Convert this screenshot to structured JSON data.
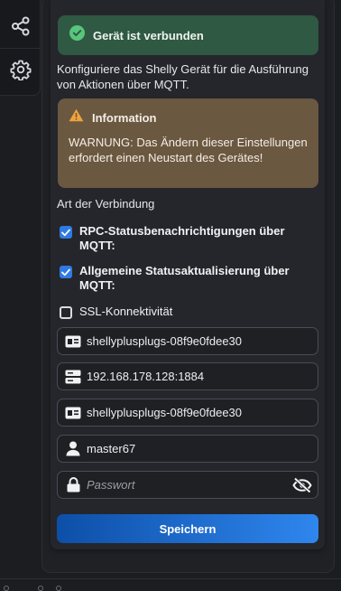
{
  "rail": {
    "icons": [
      "share-icon",
      "gear-icon"
    ]
  },
  "status": {
    "message": "Gerät ist verbunden",
    "color": "#2f5942"
  },
  "description": "Konfiguriere das Shelly Gerät für die Ausführung von Aktionen über MQTT.",
  "info": {
    "title": "Information",
    "body": "WARNUNG: Das Ändern dieser Einstellungen erfordert einen Neustart des Gerätes!",
    "color": "#6b5840"
  },
  "connection": {
    "label": "Art der Verbindung",
    "options": [
      {
        "label": "RPC-Statusbenachrichtigungen über MQTT:",
        "checked": true
      },
      {
        "label": "Allgemeine Statusaktualisierung über MQTT:",
        "checked": true
      },
      {
        "label": "SSL-Konnektivität",
        "checked": false
      }
    ]
  },
  "fields": {
    "client_id": {
      "value": "shellyplusplugs-08f9e0fdee30",
      "icon": "id-card-icon"
    },
    "server": {
      "value": "192.168.178.128:1884",
      "icon": "server-icon"
    },
    "topic_prefix": {
      "value": "shellyplusplugs-08f9e0fdee30",
      "icon": "id-card-icon"
    },
    "user": {
      "value": "master67",
      "icon": "user-icon"
    },
    "password": {
      "value": "",
      "placeholder": "Passwort",
      "icon": "lock-icon",
      "toggle_icon": "eye-slash-icon"
    }
  },
  "save_label": "Speichern",
  "accent_color": "#2f7ae5"
}
